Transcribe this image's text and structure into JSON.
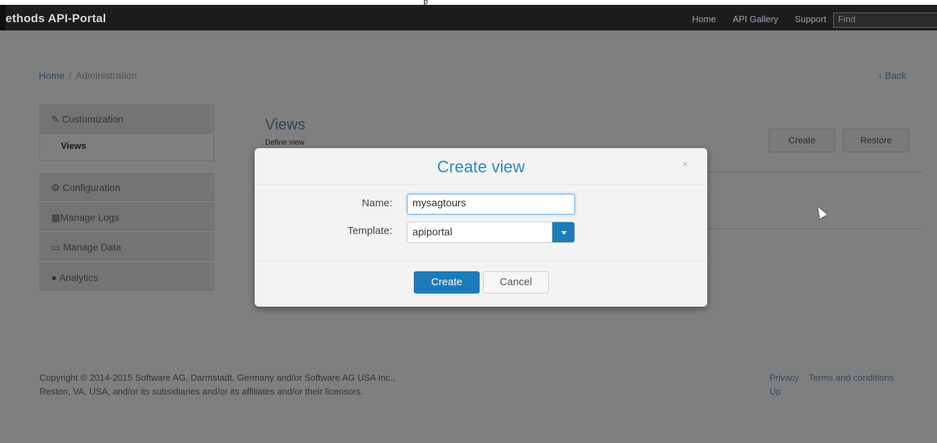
{
  "header": {
    "top_mark": "p",
    "brand": "ethods API-Portal",
    "nav": [
      "Home",
      "API Gallery",
      "Support"
    ],
    "search_placeholder": "Find"
  },
  "breadcrumb": {
    "home": "Home",
    "separator": "/",
    "current": "Administration",
    "back": "Back"
  },
  "sidebar": {
    "customization": "Customization",
    "views": "Views",
    "configuration": "Configuration",
    "manage_logs": "Manage Logs",
    "manage_data": "Manage Data",
    "analytics": "Analytics"
  },
  "content": {
    "title": "Views",
    "subtitle": "Define view",
    "create_label": "Create",
    "restore_label": "Restore"
  },
  "footer": {
    "copyright_line1": "Copyright © 2014-2015 Software AG, Darmstadt, Germany and/or Software AG USA Inc.,",
    "copyright_line2": "Reston, VA, USA, and/or its subsidiaries and/or its affiliates and/or their licensors.",
    "privacy": "Privacy",
    "terms": "Terms and conditions",
    "up": "Up"
  },
  "modal": {
    "title": "Create view",
    "close": "×",
    "name_label": "Name:",
    "name_value": "mysagtours",
    "template_label": "Template:",
    "template_value": "apiportal",
    "create_label": "Create",
    "cancel_label": "Cancel"
  },
  "colors": {
    "accent": "#1c7cbb",
    "title_blue": "#2f8ac4",
    "navbar": "#1d1d1d"
  }
}
